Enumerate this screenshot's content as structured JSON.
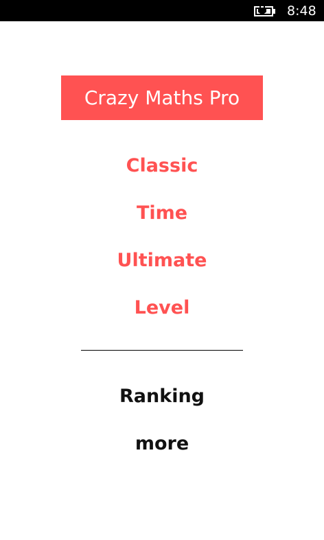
{
  "status_bar": {
    "time": "8:48",
    "battery_icon": "battery-charging-icon"
  },
  "app": {
    "title": "Crazy Maths Pro"
  },
  "colors": {
    "accent": "#ff5252",
    "text_dark": "#111111",
    "background": "#ffffff",
    "status_bar": "#000000"
  },
  "menu": {
    "modes": [
      "Classic",
      "Time",
      "Ultimate",
      "Level"
    ],
    "extras": [
      "Ranking",
      "more"
    ]
  }
}
